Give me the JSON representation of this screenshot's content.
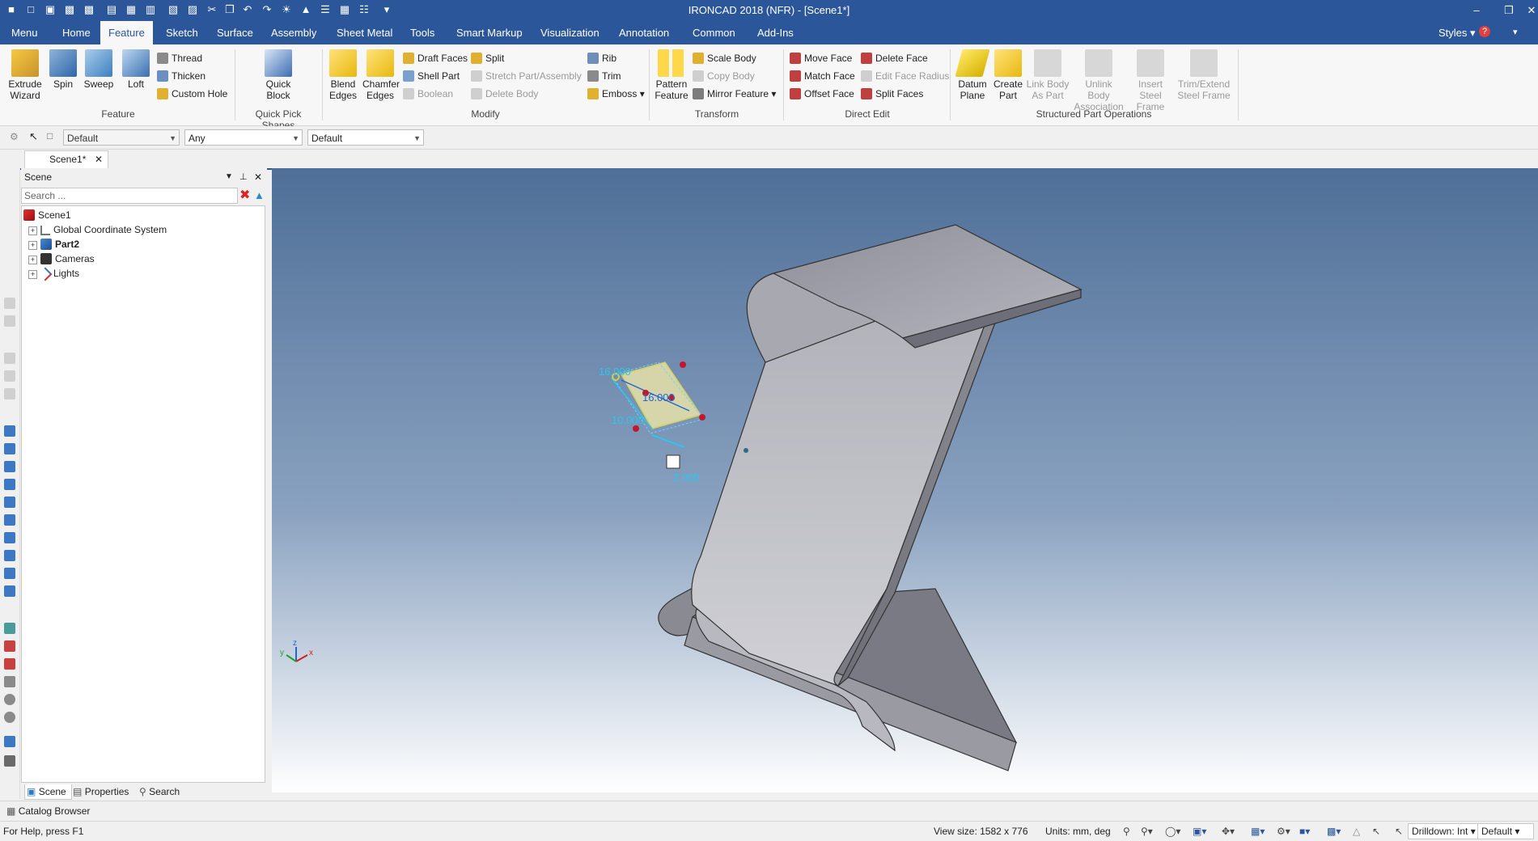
{
  "app": {
    "title": "IRONCAD 2018 (NFR) - [Scene1*]"
  },
  "window": {
    "minimize": "–",
    "restore": "❐",
    "close": "✕"
  },
  "tabs": [
    {
      "label": "Menu"
    },
    {
      "label": "Home"
    },
    {
      "label": "Feature"
    },
    {
      "label": "Sketch"
    },
    {
      "label": "Surface"
    },
    {
      "label": "Assembly"
    },
    {
      "label": "Sheet Metal"
    },
    {
      "label": "Tools"
    },
    {
      "label": "Smart Markup"
    },
    {
      "label": "Visualization"
    },
    {
      "label": "Annotation"
    },
    {
      "label": "Common"
    },
    {
      "label": "Add-Ins"
    }
  ],
  "styles_label": "Styles",
  "ribbon": {
    "feature": {
      "extrude": "Extrude Wizard",
      "spin": "Spin",
      "sweep": "Sweep",
      "loft": "Loft",
      "thread": "Thread",
      "thicken": "Thicken",
      "custom_hole": "Custom Hole",
      "group": "Feature"
    },
    "quick": {
      "block": "Quick Block",
      "group": "Quick Pick Shapes"
    },
    "modify": {
      "blend": "Blend Edges",
      "chamfer": "Chamfer Edges",
      "draft": "Draft Faces",
      "shell": "Shell Part",
      "boolean": "Boolean",
      "split": "Split",
      "stretch": "Stretch Part/Assembly",
      "delete_body": "Delete Body",
      "rib": "Rib",
      "trim": "Trim",
      "emboss": "Emboss",
      "group": "Modify"
    },
    "transform": {
      "pattern": "Pattern Feature",
      "scale": "Scale Body",
      "copy": "Copy Body",
      "mirror": "Mirror Feature",
      "group": "Transform"
    },
    "direct": {
      "move": "Move Face",
      "match": "Match Face",
      "offset": "Offset Face",
      "delete": "Delete Face",
      "edit_radius": "Edit Face Radius",
      "split_faces": "Split Faces",
      "group": "Direct Edit"
    },
    "structured": {
      "datum": "Datum Plane",
      "create_part": "Create Part",
      "link": "Link Body As Part",
      "unlink": "Unlink Body Association",
      "insert": "Insert Steel Frame",
      "trim_extend": "Trim/Extend Steel Frame",
      "group": "Structured Part Operations"
    }
  },
  "selection": {
    "combo1": "Default",
    "combo2": "Any",
    "combo3": "Default"
  },
  "doc_tab": "Scene1*",
  "panel": {
    "title": "Scene",
    "search_placeholder": "Search ...",
    "tree": [
      {
        "label": "Scene1"
      },
      {
        "label": "Global Coordinate System"
      },
      {
        "label": "Part2"
      },
      {
        "label": "Cameras"
      },
      {
        "label": "Lights"
      }
    ],
    "tabs": [
      "Scene",
      "Properties",
      "Search"
    ]
  },
  "catalog_browser": "Catalog Browser",
  "dimensions": {
    "d1": "16.000",
    "d2": "16.000",
    "d3": "10.000",
    "d4": "2.000"
  },
  "axes": {
    "x": "x",
    "y": "y",
    "z": "z"
  },
  "status": {
    "help": "For Help, press F1",
    "view_size": "View size: 1582 x  776",
    "units": "Units: mm, deg",
    "drilldown": "Drilldown: Int",
    "default": "Default"
  },
  "colors": {
    "accent": "#2b579a",
    "ribbon": "#f7f7f7",
    "dimension": "#28c8f0",
    "handle": "#c0182c",
    "sketch_fill": "#e8e2a8"
  }
}
